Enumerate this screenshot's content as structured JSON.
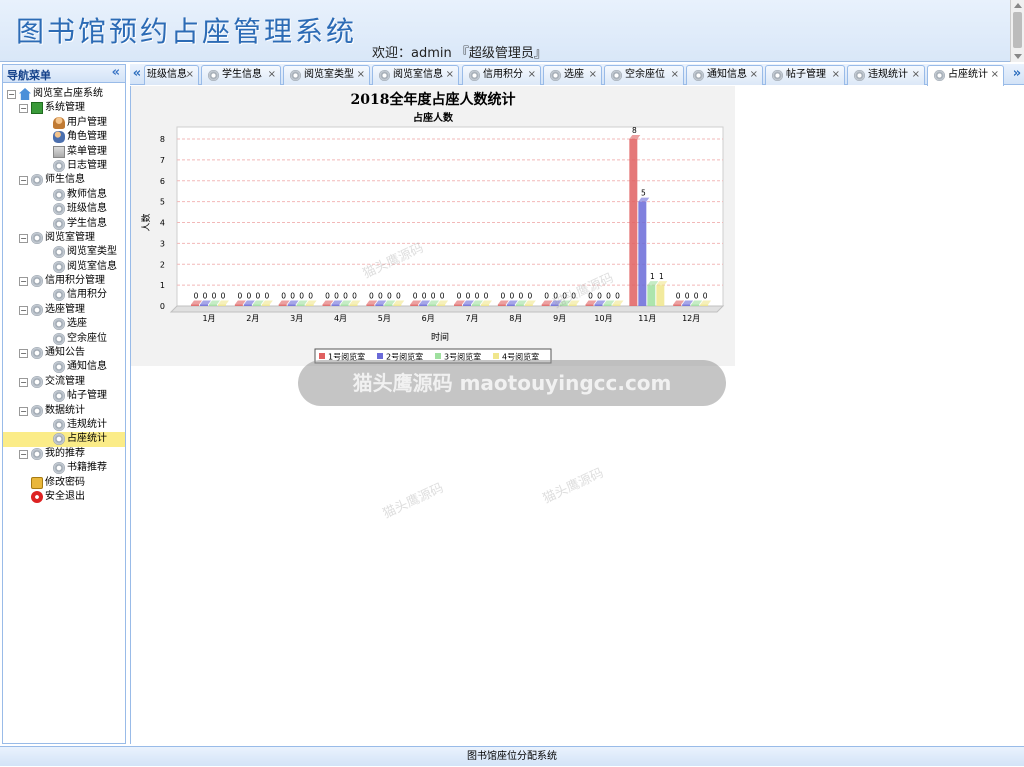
{
  "header": {
    "title": "图书馆预约占座管理系统",
    "welcome": "欢迎：admin 『超级管理员』"
  },
  "nav": {
    "title": "导航菜单",
    "collapse": "«",
    "tree": [
      {
        "label": "阅览室占座系统",
        "icon": "home-icon",
        "level": 0,
        "toggle": "−"
      },
      {
        "label": "系统管理",
        "icon": "book-icon",
        "level": 1,
        "toggle": "−"
      },
      {
        "label": "用户管理",
        "icon": "user-icon",
        "level": 2
      },
      {
        "label": "角色管理",
        "icon": "users-icon",
        "level": 2
      },
      {
        "label": "菜单管理",
        "icon": "menu-icon",
        "level": 2
      },
      {
        "label": "日志管理",
        "icon": "gear-icon",
        "level": 2
      },
      {
        "label": "师生信息",
        "icon": "gear-icon",
        "level": 1,
        "toggle": "−"
      },
      {
        "label": "教师信息",
        "icon": "gear-icon",
        "level": 2
      },
      {
        "label": "班级信息",
        "icon": "gear-icon",
        "level": 2
      },
      {
        "label": "学生信息",
        "icon": "gear-icon",
        "level": 2
      },
      {
        "label": "阅览室管理",
        "icon": "gear-icon",
        "level": 1,
        "toggle": "−"
      },
      {
        "label": "阅览室类型",
        "icon": "gear-icon",
        "level": 2
      },
      {
        "label": "阅览室信息",
        "icon": "gear-icon",
        "level": 2
      },
      {
        "label": "信用积分管理",
        "icon": "gear-icon",
        "level": 1,
        "toggle": "−"
      },
      {
        "label": "信用积分",
        "icon": "gear-icon",
        "level": 2
      },
      {
        "label": "选座管理",
        "icon": "gear-icon",
        "level": 1,
        "toggle": "−"
      },
      {
        "label": "选座",
        "icon": "gear-icon",
        "level": 2
      },
      {
        "label": "空余座位",
        "icon": "gear-icon",
        "level": 2
      },
      {
        "label": "通知公告",
        "icon": "gear-icon",
        "level": 1,
        "toggle": "−"
      },
      {
        "label": "通知信息",
        "icon": "gear-icon",
        "level": 2
      },
      {
        "label": "交流管理",
        "icon": "gear-icon",
        "level": 1,
        "toggle": "−"
      },
      {
        "label": "帖子管理",
        "icon": "gear-icon",
        "level": 2
      },
      {
        "label": "数据统计",
        "icon": "gear-icon",
        "level": 1,
        "toggle": "−"
      },
      {
        "label": "违规统计",
        "icon": "gear-icon",
        "level": 2
      },
      {
        "label": "占座统计",
        "icon": "gear-icon",
        "level": 2,
        "selected": true
      },
      {
        "label": "我的推荐",
        "icon": "gear-icon",
        "level": 1,
        "toggle": "−"
      },
      {
        "label": "书籍推荐",
        "icon": "gear-icon",
        "level": 2
      },
      {
        "label": "修改密码",
        "icon": "lock-icon",
        "level": 1
      },
      {
        "label": "安全退出",
        "icon": "exit-icon",
        "level": 1
      }
    ]
  },
  "tabs": {
    "scroll_left": "«",
    "scroll_right": "»",
    "close": "×",
    "items": [
      {
        "label": "班级信息",
        "partial": true
      },
      {
        "label": "学生信息"
      },
      {
        "label": "阅览室类型"
      },
      {
        "label": "阅览室信息"
      },
      {
        "label": "信用积分"
      },
      {
        "label": "选座"
      },
      {
        "label": "空余座位"
      },
      {
        "label": "通知信息"
      },
      {
        "label": "帖子管理"
      },
      {
        "label": "违规统计"
      },
      {
        "label": "占座统计",
        "active": true
      }
    ]
  },
  "chart_data": {
    "type": "bar",
    "title": "2018全年度占座人数统计",
    "subtitle": "占座人数",
    "xlabel": "时间",
    "ylabel": "人数",
    "ylim": [
      0,
      8
    ],
    "yticks": [
      "0",
      "1",
      "2",
      "3",
      "4",
      "5",
      "6",
      "7",
      "8"
    ],
    "categories": [
      "1月",
      "2月",
      "3月",
      "4月",
      "5月",
      "6月",
      "7月",
      "8月",
      "9月",
      "10月",
      "11月",
      "12月"
    ],
    "series": [
      {
        "name": "1号阅览室",
        "color": "#e06060",
        "values": [
          0,
          0,
          0,
          0,
          0,
          0,
          0,
          0,
          0,
          0,
          8,
          0
        ]
      },
      {
        "name": "2号阅览室",
        "color": "#6a6ad8",
        "values": [
          0,
          0,
          0,
          0,
          0,
          0,
          0,
          0,
          0,
          0,
          5,
          0
        ]
      },
      {
        "name": "3号阅览室",
        "color": "#9fe09f",
        "values": [
          0,
          0,
          0,
          0,
          0,
          0,
          0,
          0,
          0,
          0,
          1,
          0
        ]
      },
      {
        "name": "4号阅览室",
        "color": "#f0e68c",
        "values": [
          0,
          0,
          0,
          0,
          0,
          0,
          0,
          0,
          0,
          0,
          1,
          0
        ]
      }
    ],
    "legend_position": "bottom",
    "grid": true
  },
  "watermark": {
    "text": "猫头鹰源码 maotouyingcc.com",
    "diag_text": "猫头鹰源码"
  },
  "footer": {
    "text": "图书馆座位分配系统"
  }
}
